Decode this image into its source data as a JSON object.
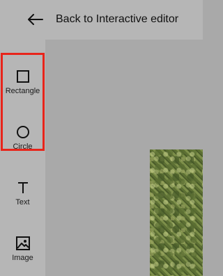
{
  "header": {
    "back_label": "Back to Interactive editor"
  },
  "toolbar": {
    "items": [
      {
        "label": "Rectangle",
        "icon": "square-icon"
      },
      {
        "label": "Circle",
        "icon": "circle-icon"
      },
      {
        "label": "Text",
        "icon": "text-t-icon"
      },
      {
        "label": "Image",
        "icon": "image-icon"
      }
    ]
  },
  "colors": {
    "highlight": "#e8241a"
  }
}
